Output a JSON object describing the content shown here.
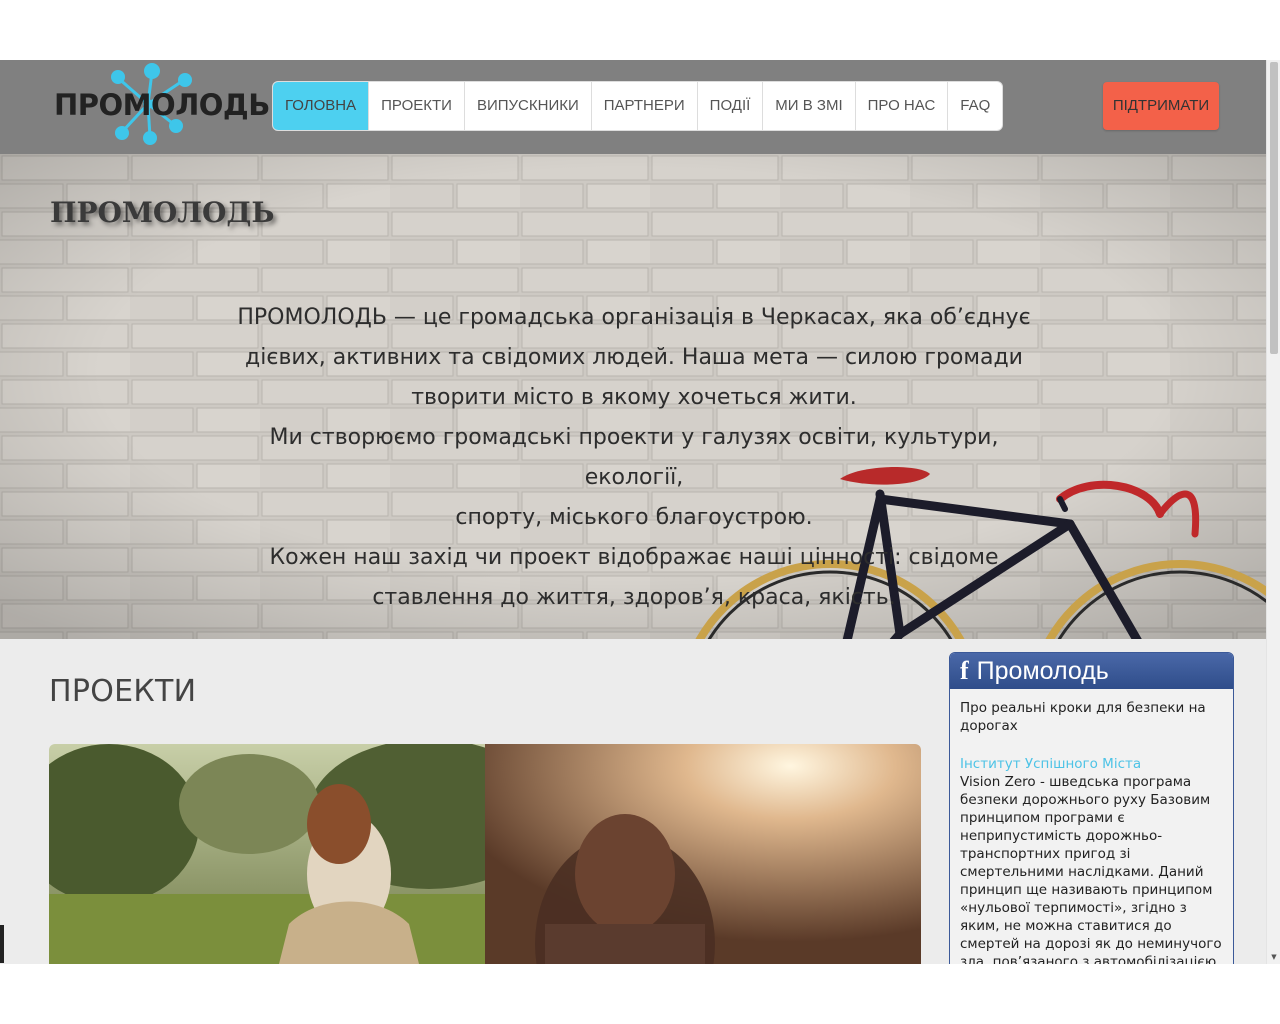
{
  "header": {
    "logo_text": "ПРОМОЛОДЬ",
    "nav": [
      {
        "label": "ГОЛОВНА",
        "active": true
      },
      {
        "label": "ПРОЕКТИ",
        "active": false
      },
      {
        "label": "ВИПУСКНИКИ",
        "active": false
      },
      {
        "label": "ПАРТНЕРИ",
        "active": false
      },
      {
        "label": "ПОДІЇ",
        "active": false
      },
      {
        "label": "МИ В ЗМІ",
        "active": false
      },
      {
        "label": "ПРО НАС",
        "active": false
      },
      {
        "label": "FAQ",
        "active": false
      }
    ],
    "support_label": "ПІДТРИМАТИ"
  },
  "hero": {
    "title": "ПРОМОЛОДЬ",
    "lines": [
      "ПРОМОЛОДЬ — це громадська організація в Черкасах, яка об’єднує",
      "дієвих, активних та свідомих людей. Наша мета — силою громади",
      "творити місто в якому хочеться жити.",
      "Ми створюємо громадські проекти у галузях освіти, культури, екології,",
      "спорту, міського благоустрою.",
      "Кожен наш захід чи проект відображає наші цінності: свідоме",
      "ставлення до життя, здоров’я, краса, якість."
    ]
  },
  "projects": {
    "title": "ПРОЕКТИ"
  },
  "facebook": {
    "page_name": "Промолодь",
    "post_title": "Про реальні кроки для безпеки на дорогах",
    "post_source": "Інститут Успішного Міста",
    "post_text": "Vision Zero - шведська програма безпеки дорожнього руху Базовим принципом програми є неприпустимість дорожньо-транспортних пригод зі смертельними наслідками. Даний принцип ще називають принципом «нульової терпимості», згідно з яким, не можна ставитися до смертей на дорозі як до неминучого зла, пов’язаного з автомобілізацією"
  },
  "colors": {
    "header_bg": "#808080",
    "nav_active": "#4dd0f0",
    "support_btn": "#f36149",
    "fb_blue": "#3b5998",
    "link": "#4dc3e6"
  }
}
